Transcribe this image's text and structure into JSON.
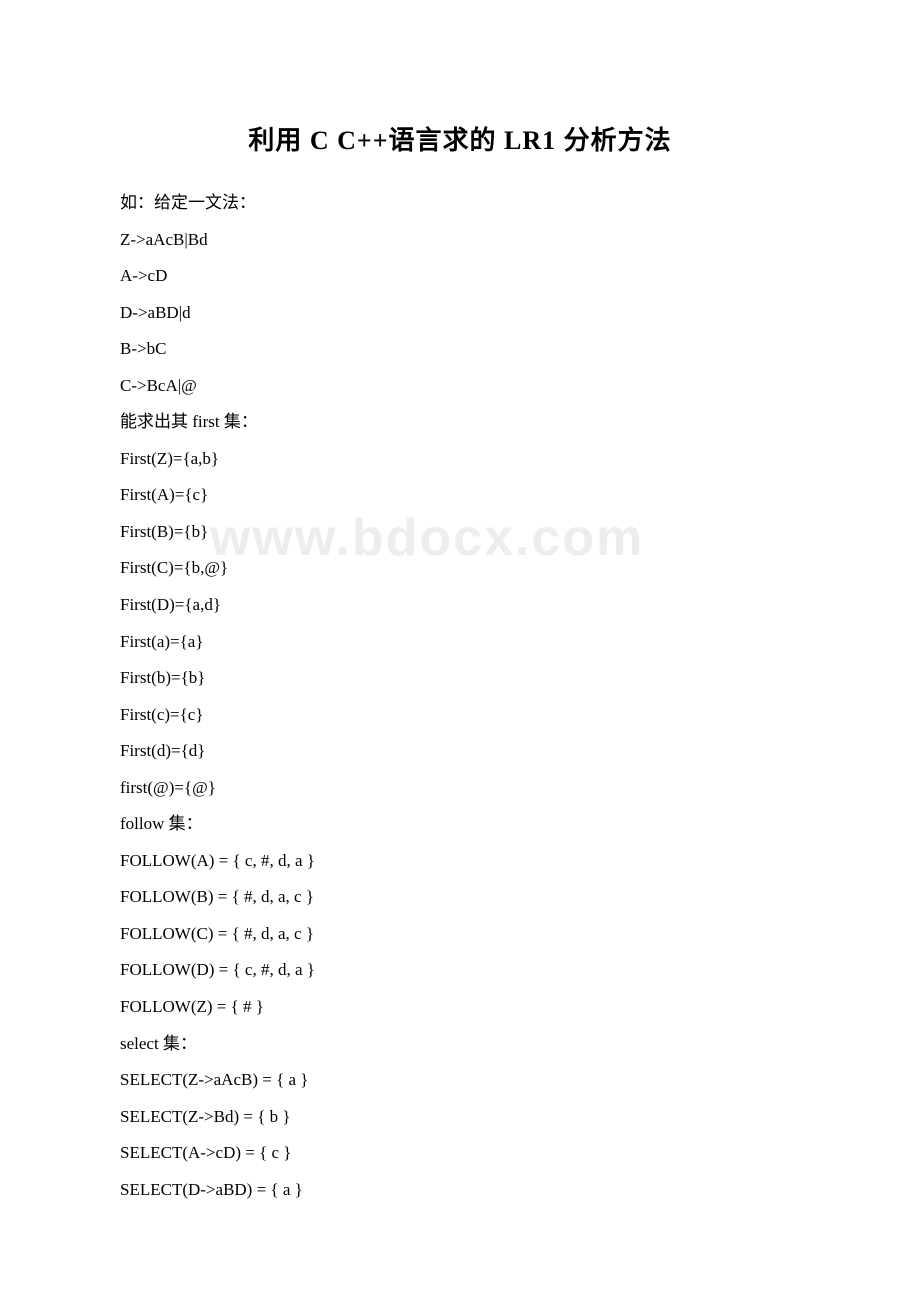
{
  "title": "利用 C C++语言求的 LR1 分析方法",
  "watermark": "www.bdocx.com",
  "lines": [
    "如：给定一文法：",
    "Z->aAcB|Bd",
    "A->cD",
    "D->aBD|d",
    "B->bC",
    "C->BcA|@",
    "能求出其 first 集：",
    "First(Z)={a,b}",
    "First(A)={c}",
    "First(B)={b}",
    "First(C)={b,@}",
    "First(D)={a,d}",
    "First(a)={a}",
    "First(b)={b}",
    "First(c)={c}",
    "First(d)={d}",
    "first(@)={@}",
    "follow 集：",
    "FOLLOW(A) = { c, #, d, a }",
    "FOLLOW(B) = { #, d, a, c }",
    "FOLLOW(C) = { #, d, a, c }",
    "FOLLOW(D) = { c, #, d, a }",
    "FOLLOW(Z) = { # }",
    "select 集：",
    "SELECT(Z->aAcB) = { a }",
    "SELECT(Z->Bd) = { b }",
    "SELECT(A->cD) = { c }",
    "SELECT(D->aBD) = { a }"
  ]
}
